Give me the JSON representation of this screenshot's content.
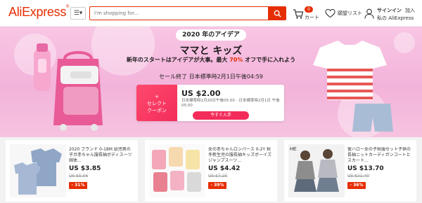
{
  "header": {
    "logo": "AliExpress",
    "search_placeholder": "I'm shopping for...",
    "cart": {
      "count": "0",
      "label": "カート"
    },
    "wishlist_label": "願望リスト",
    "account": {
      "sign_in": "サインイン",
      "join": "加入",
      "my_account": "私の AliExpress"
    }
  },
  "banner": {
    "title_pill": "2020 年のアイデア",
    "headline": "ママと キッズ",
    "subtitle_before": "新年のスタートはアイデアが大事。最大 ",
    "subtitle_highlight": "70%",
    "subtitle_after": " オフで手に入れよう",
    "sale_end": "セール終了 日本標準時2月1日午後04:59",
    "coupon": {
      "left_plus": "+",
      "left_label_1": "セレクト",
      "left_label_2": "クーポン",
      "amount": "US $2.00",
      "period": "日本標準時1月20日午後05:00 - 日本標準時2月1日 午後05:00",
      "button": "今すぐ入手"
    }
  },
  "products": [
    {
      "title": "2020 ブランド 0-18M 幼児男の子ガ赤ちゃん服長袖ボディスーツ固体...",
      "price": "US $3.85",
      "old_price": "US $5.56",
      "discount": "- 31%"
    },
    {
      "title": "女の赤ちゃんロンパース 0-2Y 秋冬新生児の服長袖キッズボーイズジャンプスーツ...",
      "price": "US $4.42",
      "old_price": "US $7.25",
      "discount": "- 39%"
    },
    {
      "title": "彼ハロー女の子秋服セット子供の長袖ニットカーディガンコートとスカート...",
      "price": "US $13.70",
      "old_price": "US $21.40",
      "discount": "- 36%"
    }
  ]
}
